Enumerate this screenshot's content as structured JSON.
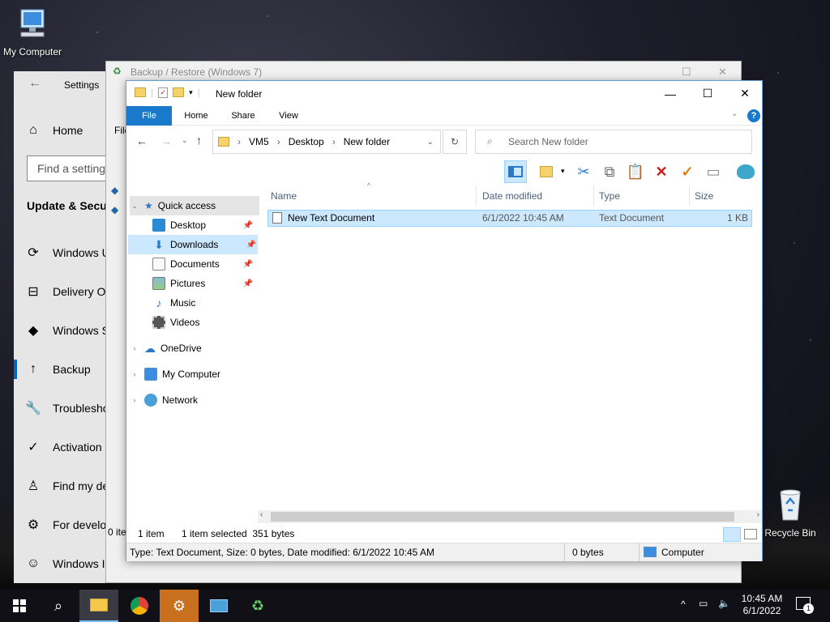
{
  "desktop": {
    "my_computer_label": "My Computer",
    "recycle_bin_label": "Recycle Bin"
  },
  "settings": {
    "title": "Settings",
    "search_placeholder": "Find a setting",
    "section": "Update & Secu",
    "items": [
      {
        "label": "Home",
        "icon": "home-icon"
      },
      {
        "label": "Windows U",
        "icon": "sync-icon"
      },
      {
        "label": "Delivery Op",
        "icon": "delivery-icon"
      },
      {
        "label": "Windows S",
        "icon": "shield-icon"
      },
      {
        "label": "Backup",
        "icon": "backup-icon"
      },
      {
        "label": "Troublesho",
        "icon": "wrench-icon"
      },
      {
        "label": "Activation",
        "icon": "check-circle-icon"
      },
      {
        "label": "Find my de",
        "icon": "person-icon"
      },
      {
        "label": "For develo",
        "icon": "developer-icon"
      },
      {
        "label": "Windows Insider Program",
        "icon": "insider-icon"
      }
    ]
  },
  "backup_window": {
    "title": "Backup / Restore (Windows 7)",
    "menu_label": "File",
    "status_fragment": "0 ite"
  },
  "explorer": {
    "title": "New folder",
    "ribbon_tabs": [
      "File",
      "Home",
      "Share",
      "View"
    ],
    "breadcrumb": [
      "VM5",
      "Desktop",
      "New folder"
    ],
    "search_placeholder": "Search New folder",
    "nav": {
      "quick_access": "Quick access",
      "items": [
        {
          "label": "Desktop",
          "pinned": true
        },
        {
          "label": "Downloads",
          "pinned": true
        },
        {
          "label": "Documents",
          "pinned": true
        },
        {
          "label": "Pictures",
          "pinned": true
        },
        {
          "label": "Music",
          "pinned": false
        },
        {
          "label": "Videos",
          "pinned": false
        }
      ],
      "onedrive": "OneDrive",
      "my_computer": "My Computer",
      "network": "Network"
    },
    "columns": [
      "Name",
      "Date modified",
      "Type",
      "Size"
    ],
    "files": [
      {
        "name": "New Text Document",
        "date": "6/1/2022 10:45 AM",
        "type": "Text Document",
        "size": "1 KB"
      }
    ],
    "status": {
      "count": "1 item",
      "selected": "1 item selected  351 bytes"
    },
    "details": {
      "info": "Type: Text Document, Size: 0 bytes, Date modified: 6/1/2022 10:45 AM",
      "size": "0 bytes",
      "location": "Computer"
    }
  },
  "taskbar": {
    "time": "10:45 AM",
    "date": "6/1/2022",
    "notification_count": "1"
  },
  "colors": {
    "accent": "#1979ca",
    "selection": "#cce8ff",
    "taskbar": "#101016"
  }
}
